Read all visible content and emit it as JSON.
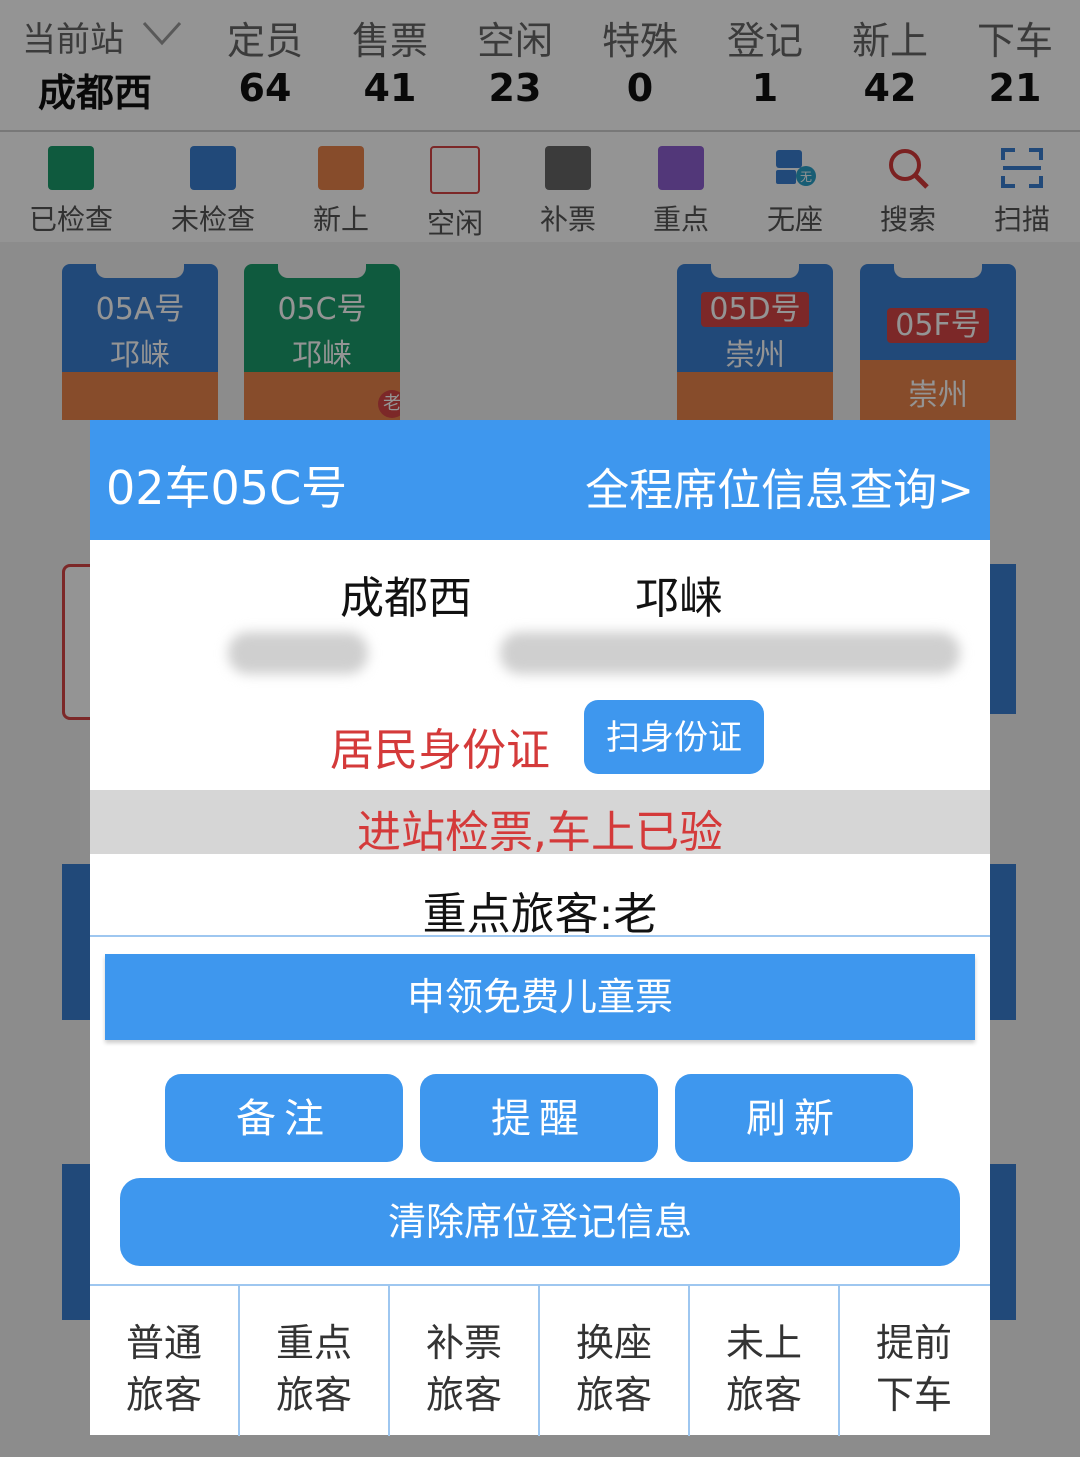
{
  "header": {
    "station_label": "当前站",
    "station_name": "成都西",
    "stats": [
      {
        "label": "定员",
        "value": "64"
      },
      {
        "label": "售票",
        "value": "41"
      },
      {
        "label": "空闲",
        "value": "23"
      },
      {
        "label": "特殊",
        "value": "0"
      },
      {
        "label": "登记",
        "value": "1"
      },
      {
        "label": "新上",
        "value": "42"
      },
      {
        "label": "下车",
        "value": "21"
      }
    ]
  },
  "legend": [
    {
      "label": "已检查",
      "color": "#1a9b6c"
    },
    {
      "label": "未检查",
      "color": "#3a7fd0"
    },
    {
      "label": "新上",
      "color": "#e8834a"
    },
    {
      "label": "空闲",
      "color": "#ffffff"
    },
    {
      "label": "补票",
      "color": "#666666"
    },
    {
      "label": "重点",
      "color": "#8e5fd0"
    },
    {
      "label": "无座",
      "color": "#3a7fd0"
    },
    {
      "label": "搜索",
      "color": "#d43a3a"
    },
    {
      "label": "扫描",
      "color": "#3a7fd0"
    }
  ],
  "seats": [
    {
      "number": "05A号",
      "dest": "邛崃"
    },
    {
      "number": "05C号",
      "dest": "邛崃",
      "badge": "老"
    },
    {
      "number": "05D号",
      "dest": "崇州"
    },
    {
      "number": "05F号",
      "dest": "崇州"
    }
  ],
  "dialog": {
    "title": "02车05C号",
    "link": "全程席位信息查询>",
    "from": "成都西",
    "to": "邛崃",
    "id_type": "居民身份证",
    "scan_id_button": "扫身份证",
    "status": "进站检票,车上已验",
    "vip": "重点旅客:老",
    "child_ticket_button": "申领免费儿童票",
    "note_button": "备注",
    "remind_button": "提醒",
    "refresh_button": "刷新",
    "clear_button": "清除席位登记信息",
    "categories": [
      {
        "l1": "普通",
        "l2": "旅客"
      },
      {
        "l1": "重点",
        "l2": "旅客"
      },
      {
        "l1": "补票",
        "l2": "旅客"
      },
      {
        "l1": "换座",
        "l2": "旅客"
      },
      {
        "l1": "未上",
        "l2": "旅客"
      },
      {
        "l1": "提前",
        "l2": "下车"
      }
    ]
  },
  "colors": {
    "accent": "#3e97ee",
    "alert": "#d43a3a"
  }
}
